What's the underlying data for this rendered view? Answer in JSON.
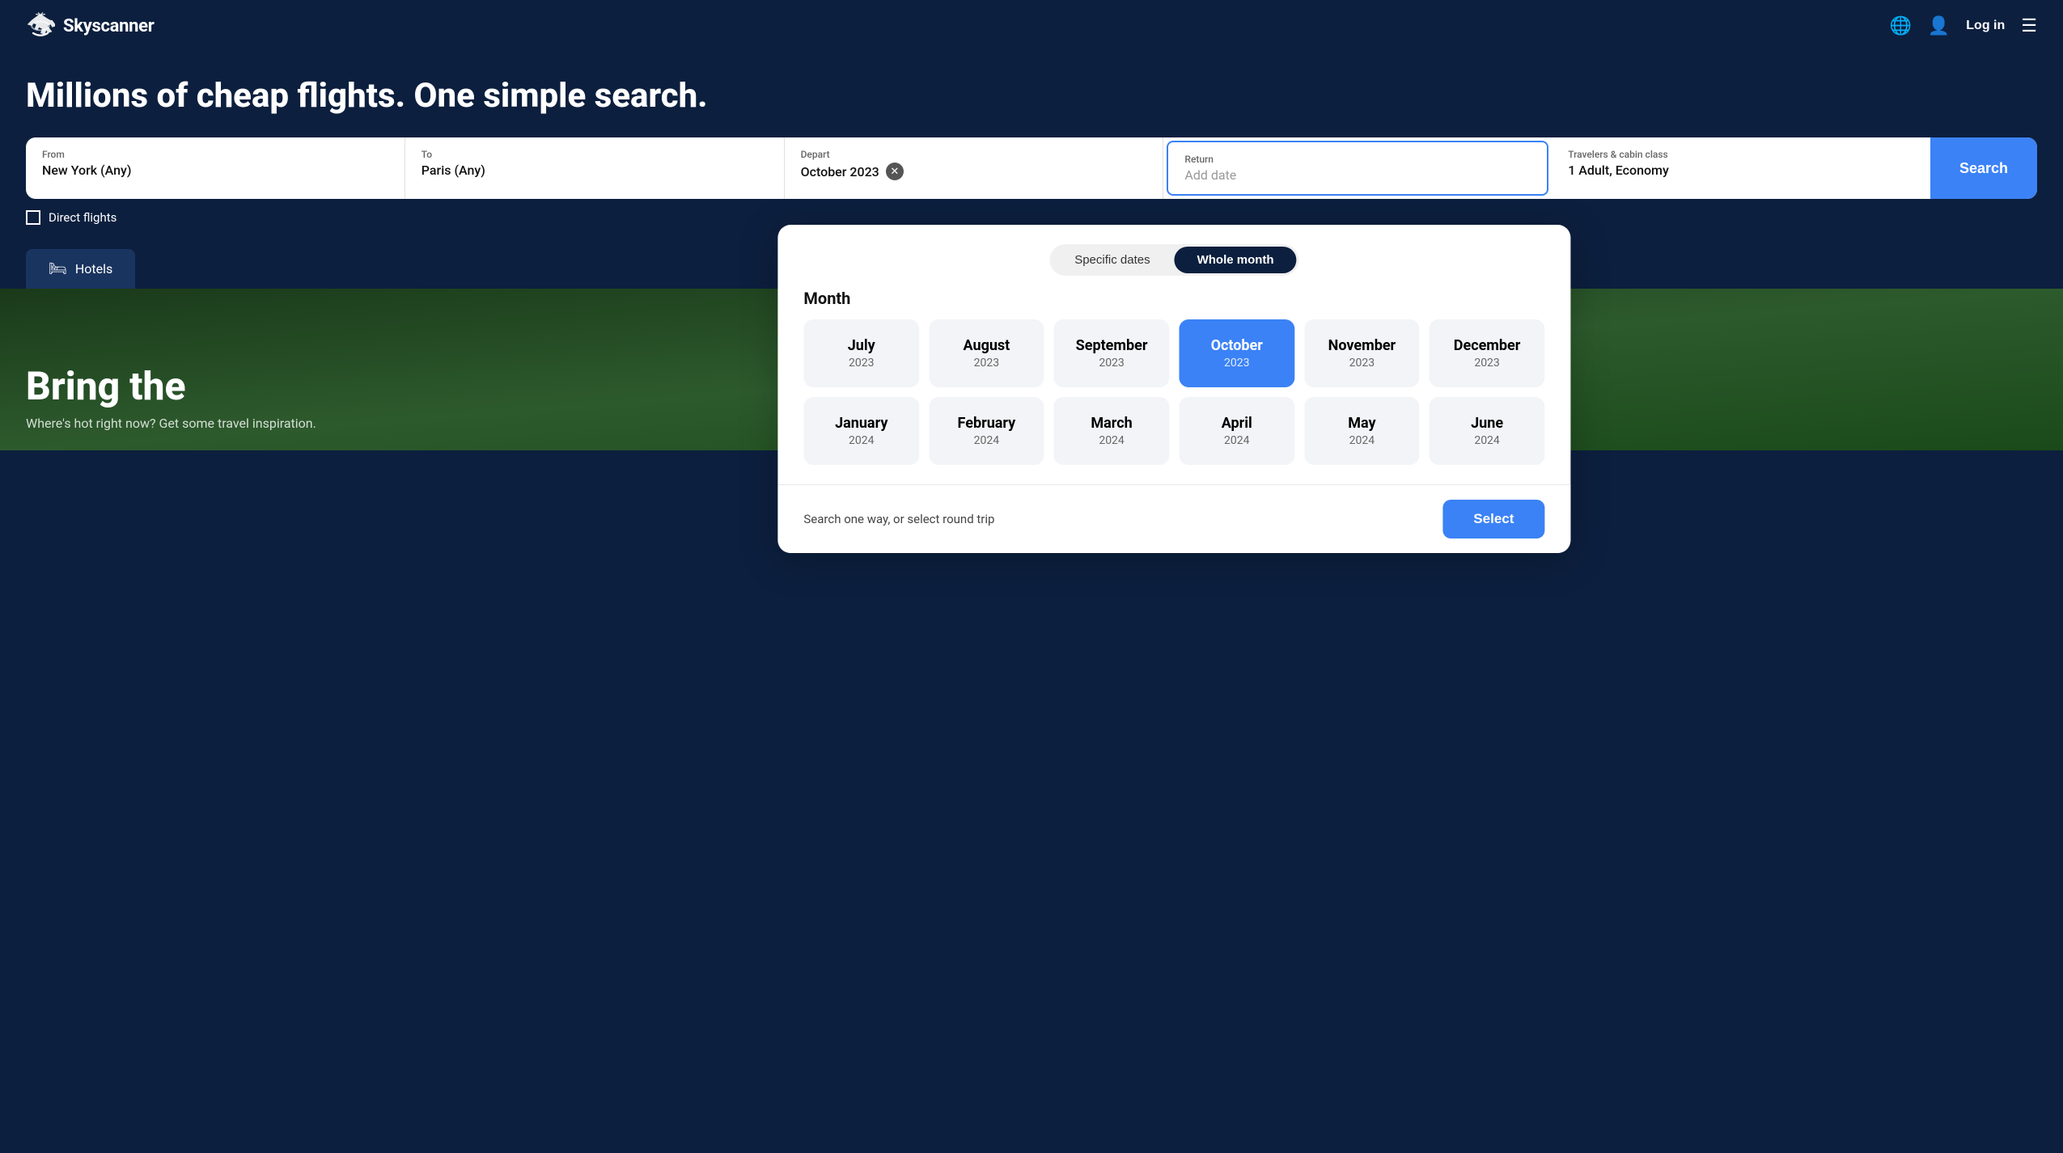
{
  "header": {
    "logo_text": "Skyscanner",
    "login_label": "Log in"
  },
  "hero": {
    "title": "Millions of cheap flights. One simple search."
  },
  "search_bar": {
    "from_label": "From",
    "from_value": "New York (Any)",
    "to_label": "To",
    "to_value": "Paris (Any)",
    "depart_label": "Depart",
    "depart_value": "October 2023",
    "return_label": "Return",
    "return_placeholder": "Add date",
    "travelers_label": "Travelers & cabin class",
    "travelers_value": "1 Adult, Economy",
    "search_btn": "Search"
  },
  "direct_flights_label": "Direct flights",
  "tabs": [
    {
      "id": "hotels",
      "label": "Hotels",
      "icon": "🛏"
    }
  ],
  "date_picker": {
    "toggle_specific": "Specific dates",
    "toggle_whole_month": "Whole month",
    "section_title": "Month",
    "months": [
      {
        "name": "July",
        "year": "2023",
        "selected": false
      },
      {
        "name": "August",
        "year": "2023",
        "selected": false
      },
      {
        "name": "September",
        "year": "2023",
        "selected": false
      },
      {
        "name": "October",
        "year": "2023",
        "selected": true
      },
      {
        "name": "November",
        "year": "2023",
        "selected": false
      },
      {
        "name": "December",
        "year": "2023",
        "selected": false
      },
      {
        "name": "January",
        "year": "2024",
        "selected": false
      },
      {
        "name": "February",
        "year": "2024",
        "selected": false
      },
      {
        "name": "March",
        "year": "2024",
        "selected": false
      },
      {
        "name": "April",
        "year": "2024",
        "selected": false
      },
      {
        "name": "May",
        "year": "2024",
        "selected": false
      },
      {
        "name": "June",
        "year": "2024",
        "selected": false
      }
    ],
    "footer_hint": "Search one way, or select round trip",
    "select_btn": "Select"
  },
  "bg_section": {
    "text": "Bring the",
    "subtext": "Where's hot right now? Get some travel inspiration."
  }
}
